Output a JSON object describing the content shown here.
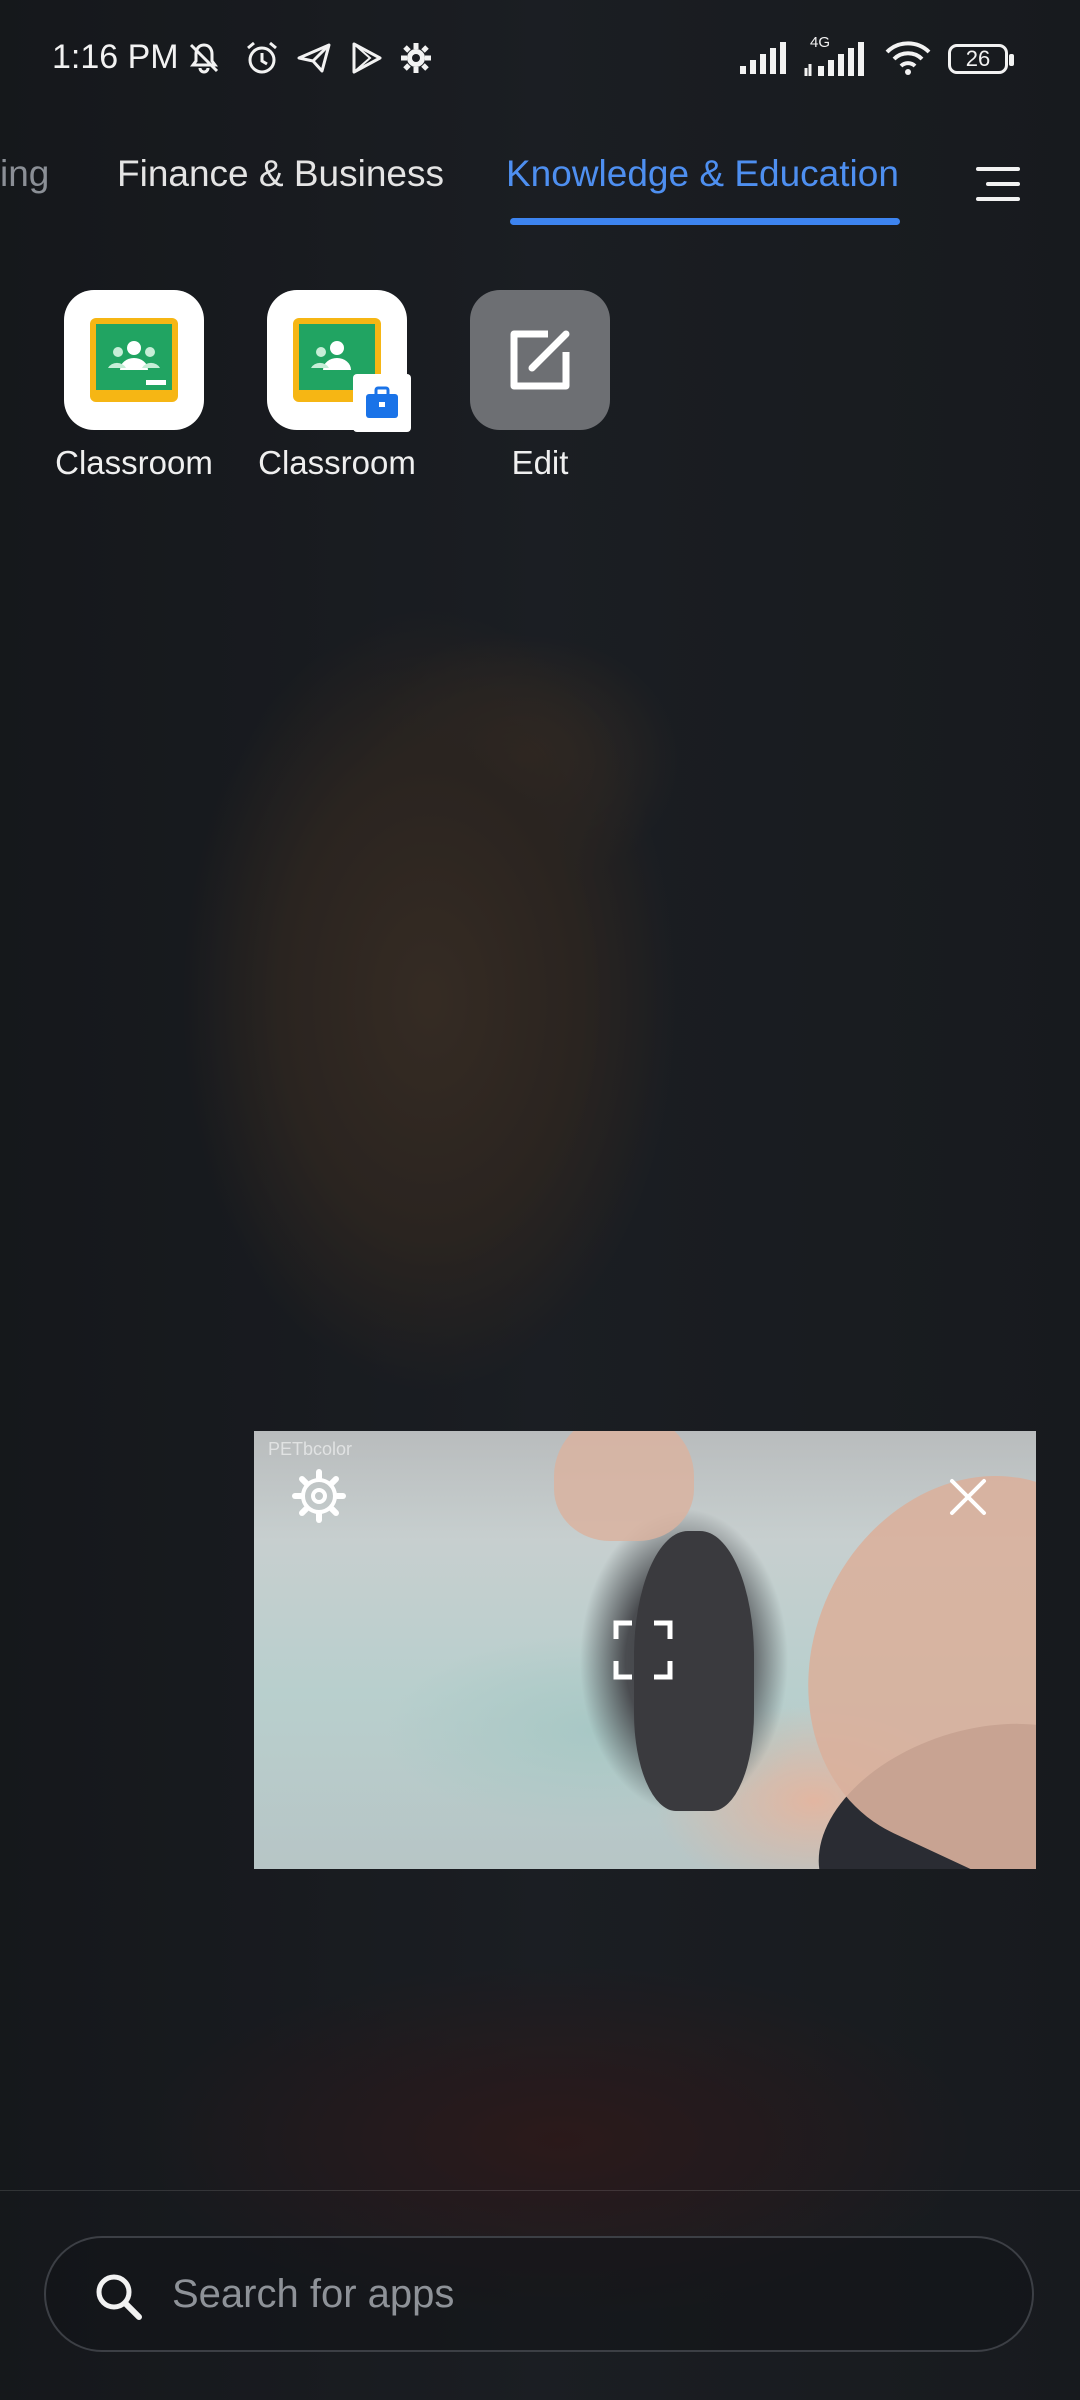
{
  "status_bar": {
    "time": "1:16 PM",
    "battery_level": "26",
    "network_label": "4G",
    "icons": [
      "mute-icon",
      "alarm-icon",
      "send-icon",
      "play-store-icon",
      "settings-icon",
      "signal-icon",
      "signal-4g-icon",
      "wifi-icon",
      "battery-icon"
    ]
  },
  "tabs": {
    "partial": "ing",
    "finance": "Finance & Business",
    "knowledge": "Knowledge & Education",
    "active": "knowledge",
    "active_color": "#3d84f0"
  },
  "apps": [
    {
      "label": "Classroom",
      "icon": "google-classroom-icon"
    },
    {
      "label": "Classroom",
      "icon": "google-classroom-work-icon"
    },
    {
      "label": "Edit",
      "icon": "edit-icon"
    }
  ],
  "pip": {
    "watermark": "PETbcolor",
    "controls": [
      "settings-icon",
      "close-icon",
      "expand-icon"
    ]
  },
  "search": {
    "placeholder": "Search for apps"
  }
}
